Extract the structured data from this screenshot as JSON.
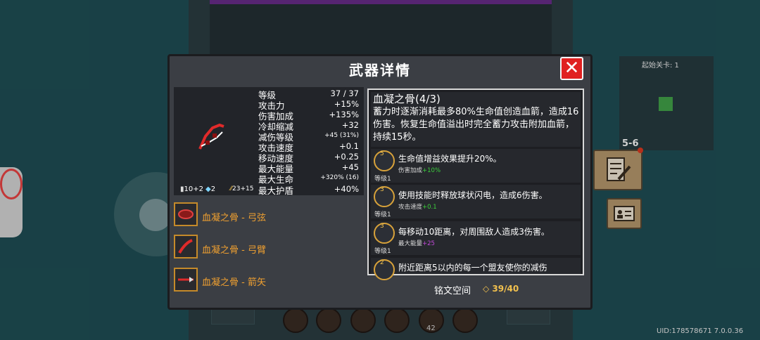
{
  "panel": {
    "title": "武器详情",
    "close_icon": "close-icon"
  },
  "weapon": {
    "icon": "blood-bow-icon",
    "stats": [
      {
        "label": "等级",
        "value": "37 / 37"
      },
      {
        "label": "攻击力",
        "value": "+15%"
      },
      {
        "label": "伤害加成",
        "value": "+135%"
      },
      {
        "label": "冷却缩减",
        "value": "+32"
      },
      {
        "label": "减伤等级",
        "value": "+45 (31%)"
      },
      {
        "label": "攻击速度",
        "value": "+0.1"
      },
      {
        "label": "移动速度",
        "value": "+0.25"
      },
      {
        "label": "最大能量",
        "value": "+45"
      },
      {
        "label": "最大生命",
        "value": "+320% (16)"
      },
      {
        "label": "最大护盾",
        "value": "+40%"
      }
    ],
    "bottom": {
      "damage": "10+2",
      "crit": "2",
      "energy": "23+15"
    }
  },
  "parts": [
    {
      "label": "血凝之骨 - 弓弦",
      "icon": "bowstring-icon"
    },
    {
      "label": "血凝之骨 - 弓臂",
      "icon": "bow-limb-icon"
    },
    {
      "label": "血凝之骨 - 箭矢",
      "icon": "arrow-icon"
    }
  ],
  "description": {
    "title": "血凝之骨(4/3)",
    "text": "蓄力时逐渐消耗最多80%生命值创造血箭，造成16伤害。恢复生命值溢出时完全蓄力攻击附加血箭，持续15秒。"
  },
  "runes": [
    {
      "text": "生命值增益效果提升20%。",
      "level": "等级1",
      "stat": "伤害加成",
      "bonus": "+10%",
      "badge": "5"
    },
    {
      "text": "使用技能时释放球状闪电，造成6伤害。",
      "level": "等级1",
      "stat": "攻击速度",
      "bonus": "+0.1",
      "badge": "3"
    },
    {
      "text": "每移动10距离，对周围敌人造成3伤害。",
      "level": "等级1",
      "stat": "最大能量",
      "bonus": "+25",
      "badge": "3"
    },
    {
      "text": "附近距离5以内的每一个盟友使你的减伤",
      "level": "",
      "stat": "",
      "bonus": "",
      "badge": "2"
    }
  ],
  "inscription": {
    "label": "铭文空间",
    "value": "39/40"
  },
  "minimap": {
    "title": "起始关卡: 1",
    "level": "5-6"
  },
  "uid": "UID:178578671 7.0.0.36",
  "skillbar": {
    "number": "42"
  },
  "colors": {
    "accent": "#f0a030",
    "close": "#e02020",
    "bonus_green": "#3ccf3c",
    "bonus_purple": "#c04ad8"
  }
}
